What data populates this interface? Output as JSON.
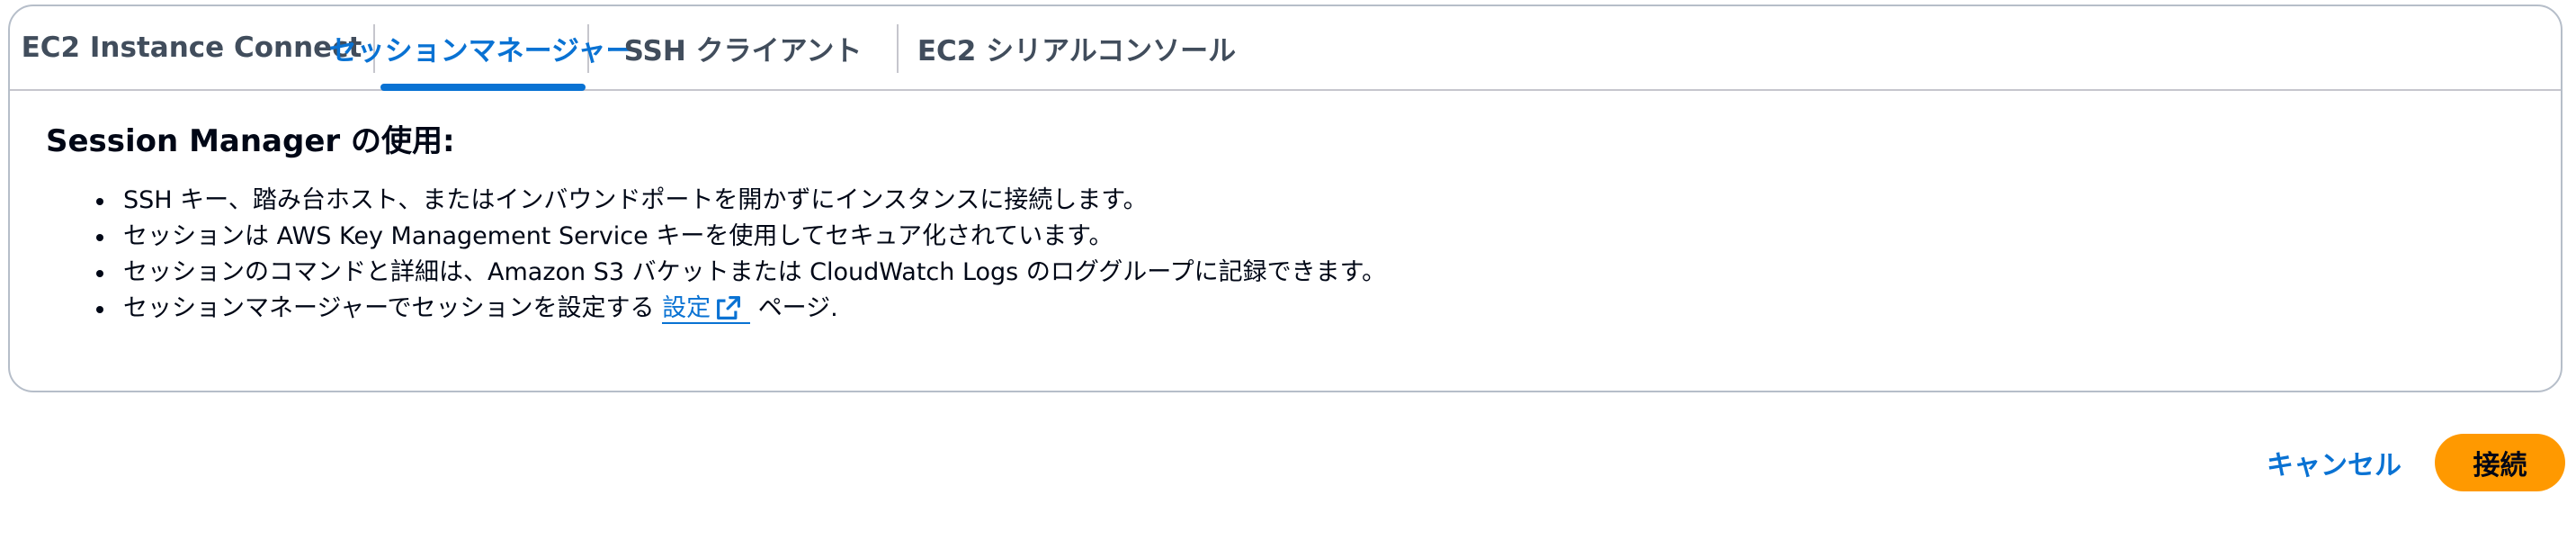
{
  "tabs": [
    {
      "label": "EC2 Instance Connect",
      "active": false
    },
    {
      "label": "セッションマネージャー",
      "active": true
    },
    {
      "label": "SSH クライアント",
      "active": false
    },
    {
      "label": "EC2 シリアルコンソール",
      "active": false
    }
  ],
  "panel": {
    "heading": "Session Manager の使用:",
    "bullets": [
      "SSH キー、踏み台ホスト、またはインバウンドポートを開かずにインスタンスに接続します。",
      "セッションは AWS Key Management Service キーを使用してセキュア化されています。",
      "セッションのコマンドと詳細は、Amazon S3 バケットまたは CloudWatch Logs のロググループに記録できます。"
    ],
    "last_bullet": {
      "prefix": "セッションマネージャーでセッションを設定する",
      "link": "設定",
      "suffix": "ページ."
    }
  },
  "footer": {
    "cancel_label": "キャンセル",
    "connect_label": "接続"
  },
  "colors": {
    "accent": "#0972d3",
    "primary_button": "#ff9900",
    "text": "#000716",
    "border": "#b6bec9"
  },
  "icons": {
    "link_icon": "external-link-icon"
  }
}
